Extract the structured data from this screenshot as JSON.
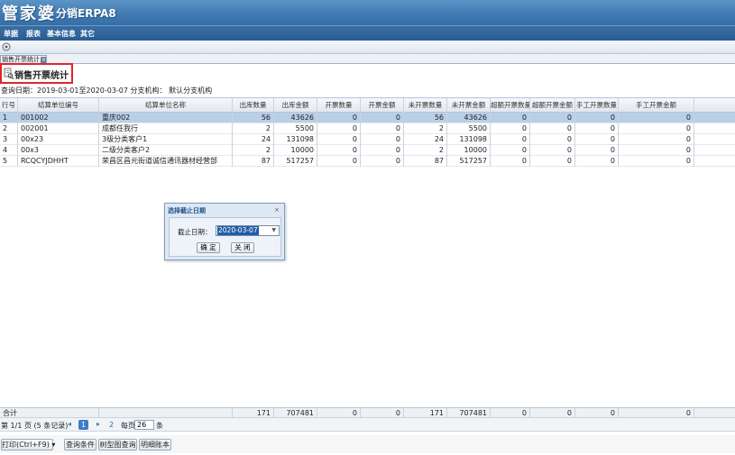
{
  "app": {
    "logo_main": "管家婆",
    "logo_sub": "分销ERPA8"
  },
  "menu": [
    {
      "label": "单据"
    },
    {
      "label": "报表"
    },
    {
      "label": "基本信息"
    },
    {
      "label": "其它"
    }
  ],
  "tab": {
    "label": "销售开票统计",
    "close": "×"
  },
  "page": {
    "title": "销售开票统计",
    "query_text": "查询日期：2019-03-01至2020-03-07    分支机构：   默认分支机构"
  },
  "table": {
    "headers": [
      "行号",
      "结算单位编号",
      "结算单位名称",
      "出库数量",
      "出库金额",
      "开票数量",
      "开票金额",
      "未开票数量",
      "未开票金额",
      "超额开票数量",
      "超额开票金额",
      "手工开票数量",
      "手工开票金额"
    ],
    "rows": [
      [
        "1",
        "001002",
        "重庆002",
        "56",
        "43626",
        "0",
        "0",
        "56",
        "43626",
        "0",
        "0",
        "0",
        "0"
      ],
      [
        "2",
        "002001",
        "成都任我行",
        "2",
        "5500",
        "0",
        "0",
        "2",
        "5500",
        "0",
        "0",
        "0",
        "0"
      ],
      [
        "3",
        "00x23",
        "3级分类客户1",
        "24",
        "131098",
        "0",
        "0",
        "24",
        "131098",
        "0",
        "0",
        "0",
        "0"
      ],
      [
        "4",
        "00x3",
        "二级分类客户2",
        "2",
        "10000",
        "0",
        "0",
        "2",
        "10000",
        "0",
        "0",
        "0",
        "0"
      ],
      [
        "5",
        "RCQCYJDHHT",
        "荣昌区昌元街道诚信通讯器材经营部",
        "87",
        "517257",
        "0",
        "0",
        "87",
        "517257",
        "0",
        "0",
        "0",
        "0"
      ]
    ],
    "footer": [
      "合计",
      "",
      "",
      "171",
      "707481",
      "0",
      "0",
      "171",
      "707481",
      "0",
      "0",
      "0",
      "0"
    ]
  },
  "pager": {
    "info": "第 1/1 页 (5 条记录)",
    "first": "◂",
    "prev": "◂",
    "current": "1",
    "next": "▸",
    "jump_page": "2",
    "per_page_label": "每页",
    "per_page_value": "26",
    "per_page_unit": "条"
  },
  "bottom_buttons": {
    "print": "打印(Ctrl+F9)",
    "query": "查询条件",
    "tree": "树型图查询",
    "detail": "明细账本"
  },
  "dialog": {
    "title": "选择截止日期",
    "close": "×",
    "label": "截止日期：",
    "value": "2020-03-07",
    "ok": "确 定",
    "cancel": "关 闭"
  },
  "colors": {
    "banner": "#3f79b1",
    "selected_row": "#b9cfe8",
    "highlight_border": "#e0262b"
  }
}
